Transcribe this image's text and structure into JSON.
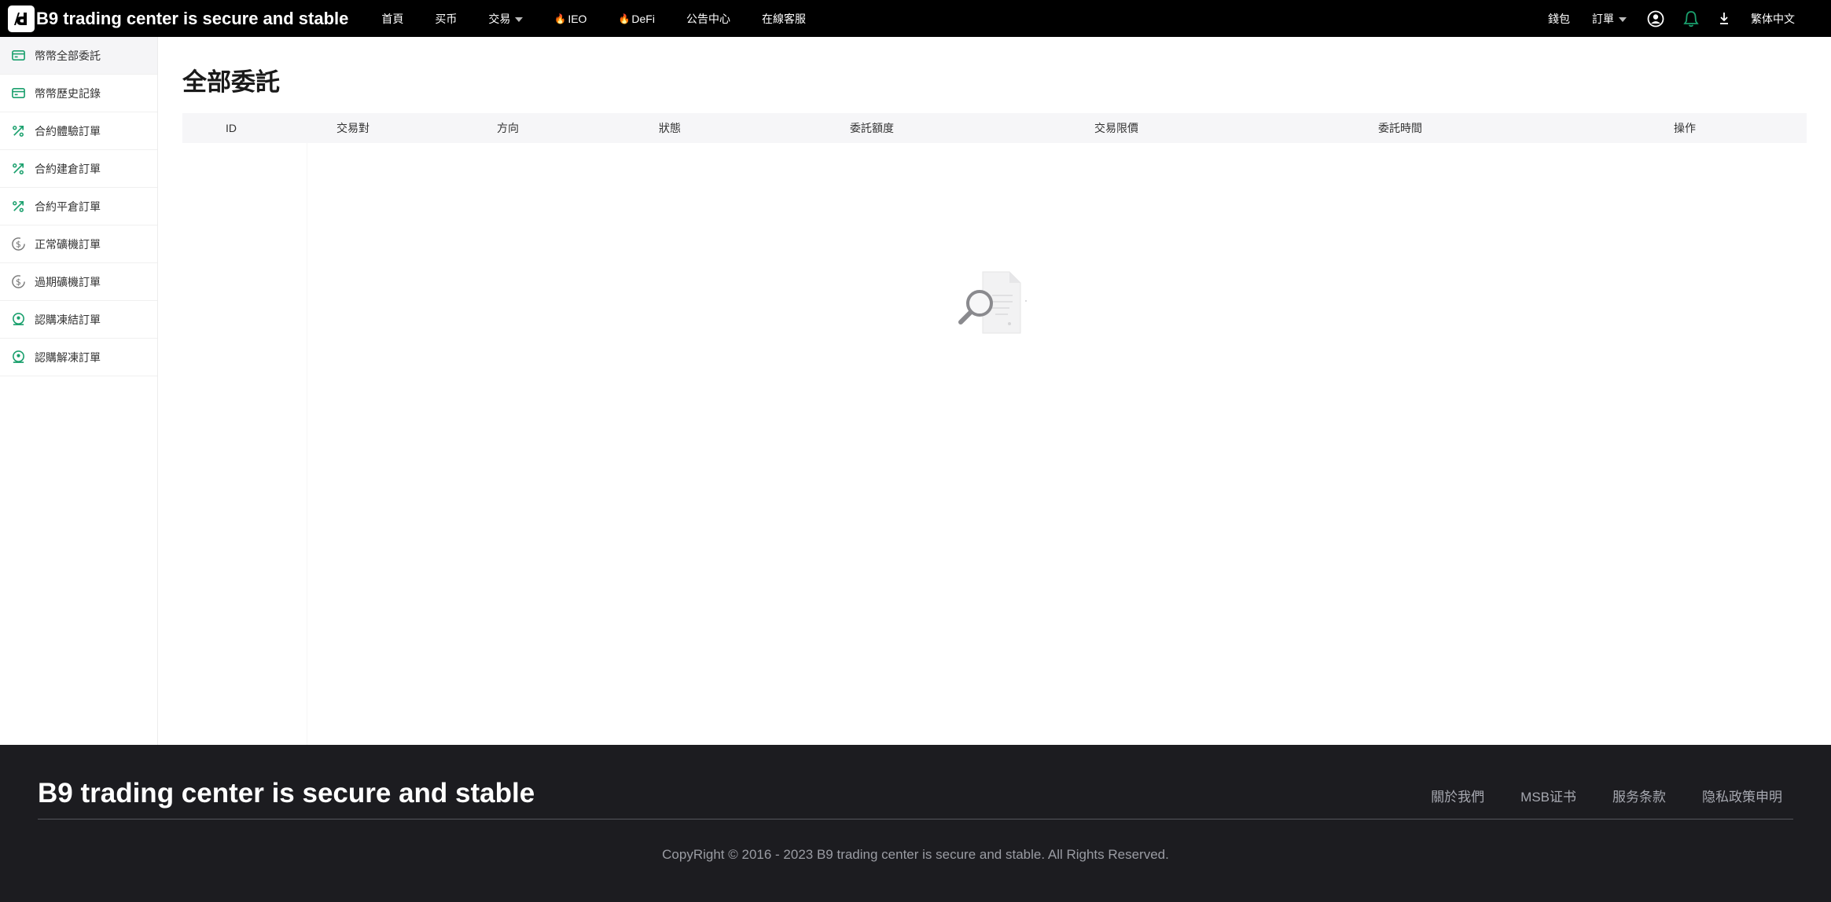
{
  "header": {
    "brand": "B9 trading center is secure and stable",
    "nav": [
      {
        "label": "首頁"
      },
      {
        "label": "买币"
      },
      {
        "label": "交易",
        "dropdown": true
      },
      {
        "label": "IEO",
        "hot": true
      },
      {
        "label": "DeFi",
        "hot": true
      },
      {
        "label": "公告中心"
      },
      {
        "label": "在線客服"
      }
    ],
    "right": {
      "wallet": "錢包",
      "orders": "訂單",
      "language": "繁体中文"
    }
  },
  "sidebar": {
    "items": [
      {
        "label": "幣幣全部委託",
        "icon": "wallet-icon",
        "active": true
      },
      {
        "label": "幣幣歷史記錄",
        "icon": "wallet-icon"
      },
      {
        "label": "合約體驗訂單",
        "icon": "percent-arrows-icon"
      },
      {
        "label": "合約建倉訂單",
        "icon": "percent-arrows-icon"
      },
      {
        "label": "合約平倉訂單",
        "icon": "percent-arrows-icon"
      },
      {
        "label": "正常礦機訂單",
        "icon": "dollar-coin-icon"
      },
      {
        "label": "過期礦機訂單",
        "icon": "dollar-coin-icon"
      },
      {
        "label": "認購凍結訂單",
        "icon": "subscribe-icon"
      },
      {
        "label": "認購解凍訂單",
        "icon": "subscribe-icon"
      }
    ]
  },
  "main": {
    "title": "全部委託",
    "columns": [
      "ID",
      "交易對",
      "方向",
      "狀態",
      "委託額度",
      "交易限價",
      "委託時間",
      "操作"
    ]
  },
  "footer": {
    "brand": "B9 trading center is secure and stable",
    "links": [
      "關於我們",
      "MSB证书",
      "服务条款",
      "隐私政策申明"
    ],
    "copyright": "CopyRight © 2016 - 2023 B9 trading center is secure and stable. All Rights Reserved."
  },
  "colors": {
    "accent": "#1aa06d",
    "header_bg": "#000000",
    "footer_bg": "#1c1c20"
  }
}
